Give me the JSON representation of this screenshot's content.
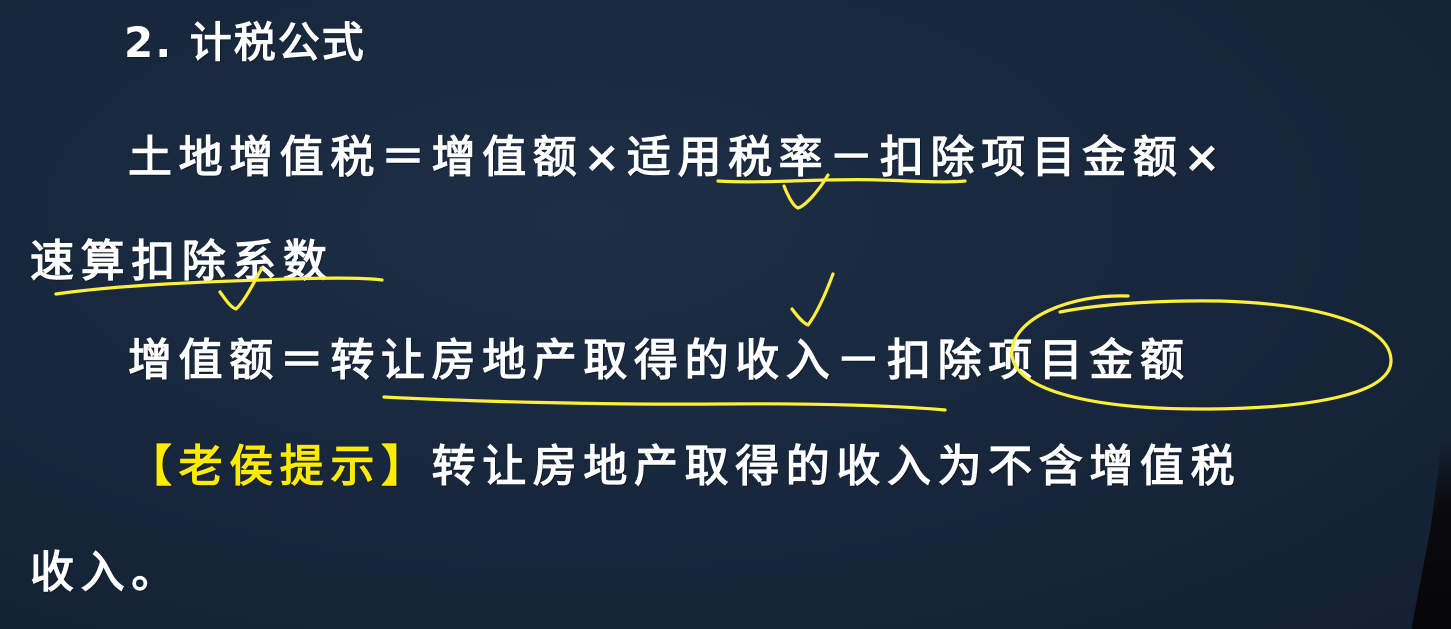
{
  "slide": {
    "heading": "2. 计税公式",
    "formula1_line1": "土地增值税＝增值额×适用税率－扣除项目金额×",
    "formula1_line2": "速算扣除系数",
    "formula2": "增值额＝转让房地产取得的收入－扣除项目金额",
    "tip_label": "【老侯提示】",
    "tip_text_line1": "转让房地产取得的收入为不含增值税",
    "tip_text_line2": "收入。"
  },
  "colors": {
    "background": "#17263a",
    "text": "#ffffff",
    "tip_label": "#ffea00",
    "annotation": "#ffee3a"
  },
  "annotations": {
    "marks": [
      "underline",
      "check-mark",
      "underline",
      "check-mark",
      "check-mark",
      "underline",
      "circle"
    ]
  }
}
